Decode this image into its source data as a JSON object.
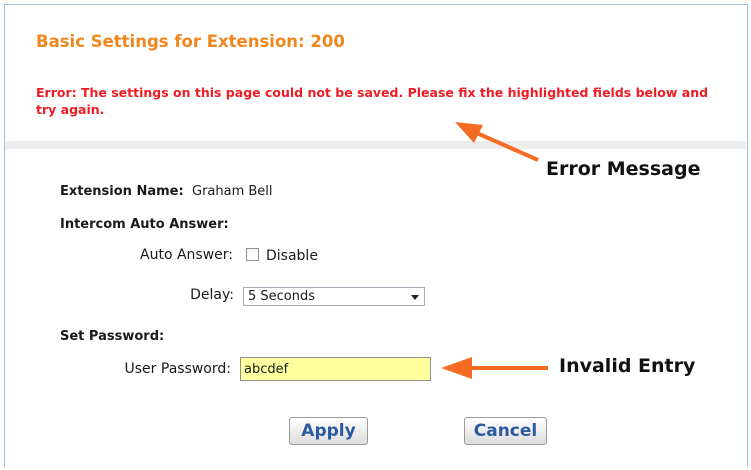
{
  "header": {
    "title": "Basic Settings for Extension: 200"
  },
  "error": {
    "message": "Error: The settings on this page could not be saved. Please fix the highlighted fields below and try again."
  },
  "extension": {
    "label": "Extension Name:",
    "value": "Graham Bell"
  },
  "intercom": {
    "heading": "Intercom Auto Answer:",
    "auto_answer_label": "Auto Answer:",
    "checkbox_label": "Disable",
    "checked": false,
    "delay_label": "Delay:",
    "delay_value": "5 Seconds"
  },
  "password": {
    "heading": "Set Password:",
    "user_password_label": "User Password:",
    "user_password_value": "abcdef",
    "invalid": true
  },
  "buttons": {
    "apply": "Apply",
    "cancel": "Cancel"
  },
  "annotations": {
    "error_callout": "Error Message",
    "invalid_callout": "Invalid Entry",
    "arrow_color": "#f36c21"
  },
  "colors": {
    "title": "#f0871e",
    "error": "#ee1c24",
    "invalid_field": "#ffff9e",
    "button_text": "#2b5aa1"
  }
}
